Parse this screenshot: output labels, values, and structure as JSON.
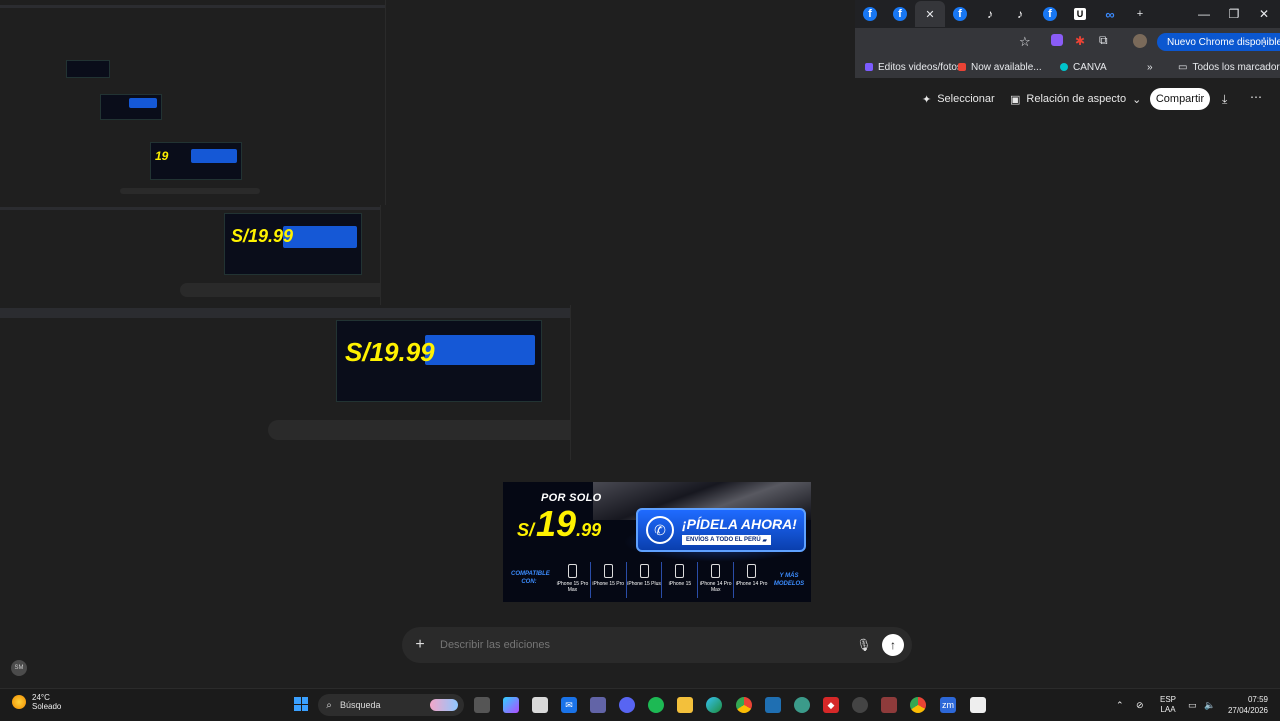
{
  "browser": {
    "tabs": [
      {
        "icon": "meta-icon"
      },
      {
        "icon": "facebook-icon"
      },
      {
        "icon": "facebook-icon"
      },
      {
        "icon": "facebook-icon",
        "active": true
      },
      {
        "icon": "facebook-icon"
      },
      {
        "icon": "tiktok-icon"
      },
      {
        "icon": "tiktok-icon"
      },
      {
        "icon": "facebook-icon"
      },
      {
        "icon": "u-icon"
      },
      {
        "icon": "meta-icon"
      }
    ],
    "new_tab": "+",
    "window_controls": {
      "minimize": "—",
      "maximize": "❐",
      "close": "✕"
    },
    "chrome_available": "Nuevo Chrome disponible",
    "bookmarks": [
      {
        "label": "Editos videos/fotos",
        "color": "#7c5cff"
      },
      {
        "label": "Now available...",
        "color": "#ea4335"
      },
      {
        "label": "CANVA",
        "color": "#00c4cc"
      }
    ],
    "bookmarks_more": "»",
    "all_bookmarks": "Todos los marcadores"
  },
  "actions": {
    "select": "Seleccionar",
    "aspect_ratio": "Relación de aspecto",
    "share": "Compartir"
  },
  "ad": {
    "por_solo": "POR SOLO",
    "currency": "S/",
    "price_int": "19",
    "price_dec": ".99",
    "cta": "¡PÍDELA AHORA!",
    "shipping": "ENVÍOS A TODO EL PERÚ",
    "compatible": "COMPATIBLE CON:",
    "more": "Y MÁS MODELOS",
    "phones": [
      {
        "name": "iPhone 15 Pro Max"
      },
      {
        "name": "iPhone 15 Pro"
      },
      {
        "name": "iPhone 15 Plus"
      },
      {
        "name": "iPhone 15"
      },
      {
        "name": "iPhone 14 Pro Max"
      },
      {
        "name": "iPhone 14 Pro"
      }
    ]
  },
  "describe": {
    "placeholder": "Describir las ediciones"
  },
  "avatar": "SM",
  "taskbar": {
    "temperature": "24°C",
    "weather": "Soleado",
    "search": "Búsqueda",
    "lang_top": "ESP",
    "lang_bottom": "LAA",
    "time": "07:59",
    "date": "27/04/2026"
  },
  "colors": {
    "accent_blue": "#0b57d0",
    "price_yellow": "#fff200",
    "background": "#1f1f1f"
  }
}
